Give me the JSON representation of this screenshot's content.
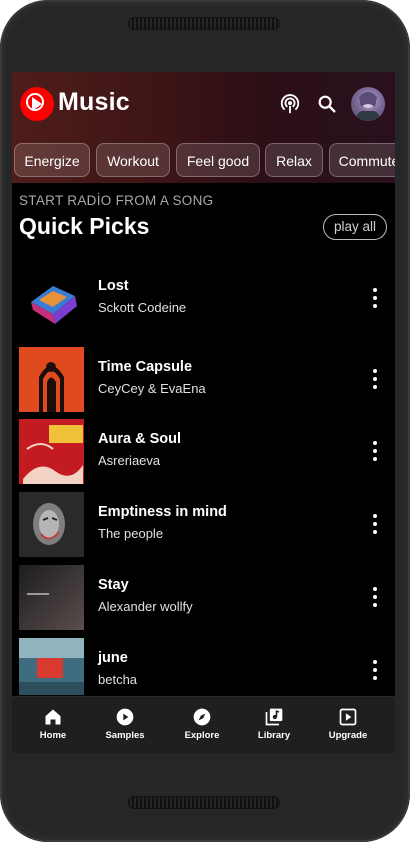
{
  "app": {
    "title": "Music"
  },
  "header": {
    "icons": [
      "cast-icon",
      "search-icon",
      "avatar"
    ]
  },
  "chips": [
    "Energize",
    "Workout",
    "Feel good",
    "Relax",
    "Commute"
  ],
  "section": {
    "subtitle": "START RADİO FROM A SONG",
    "title": "Quick Picks",
    "play_all": "play all"
  },
  "songs": [
    {
      "title": "Lost",
      "artist": "Sckott Codeine"
    },
    {
      "title": "Time Capsule",
      "artist": "CeyCey & EvaEna"
    },
    {
      "title": "Aura & Soul",
      "artist": "Asreriaeva"
    },
    {
      "title": "Emptiness in mind",
      "artist": "The people"
    },
    {
      "title": "Stay",
      "artist": "Alexander wollfy"
    },
    {
      "title": "june",
      "artist": "betcha"
    }
  ],
  "nav": [
    {
      "label": "Home",
      "icon": "home-icon"
    },
    {
      "label": "Samples",
      "icon": "play-circle-icon"
    },
    {
      "label": "Explore",
      "icon": "compass-icon"
    },
    {
      "label": "Library",
      "icon": "library-icon"
    },
    {
      "label": "Upgrade",
      "icon": "upgrade-icon"
    }
  ],
  "colors": {
    "brand_red": "#ff0000",
    "background": "#000000",
    "nav_background": "#1f1f1f"
  }
}
